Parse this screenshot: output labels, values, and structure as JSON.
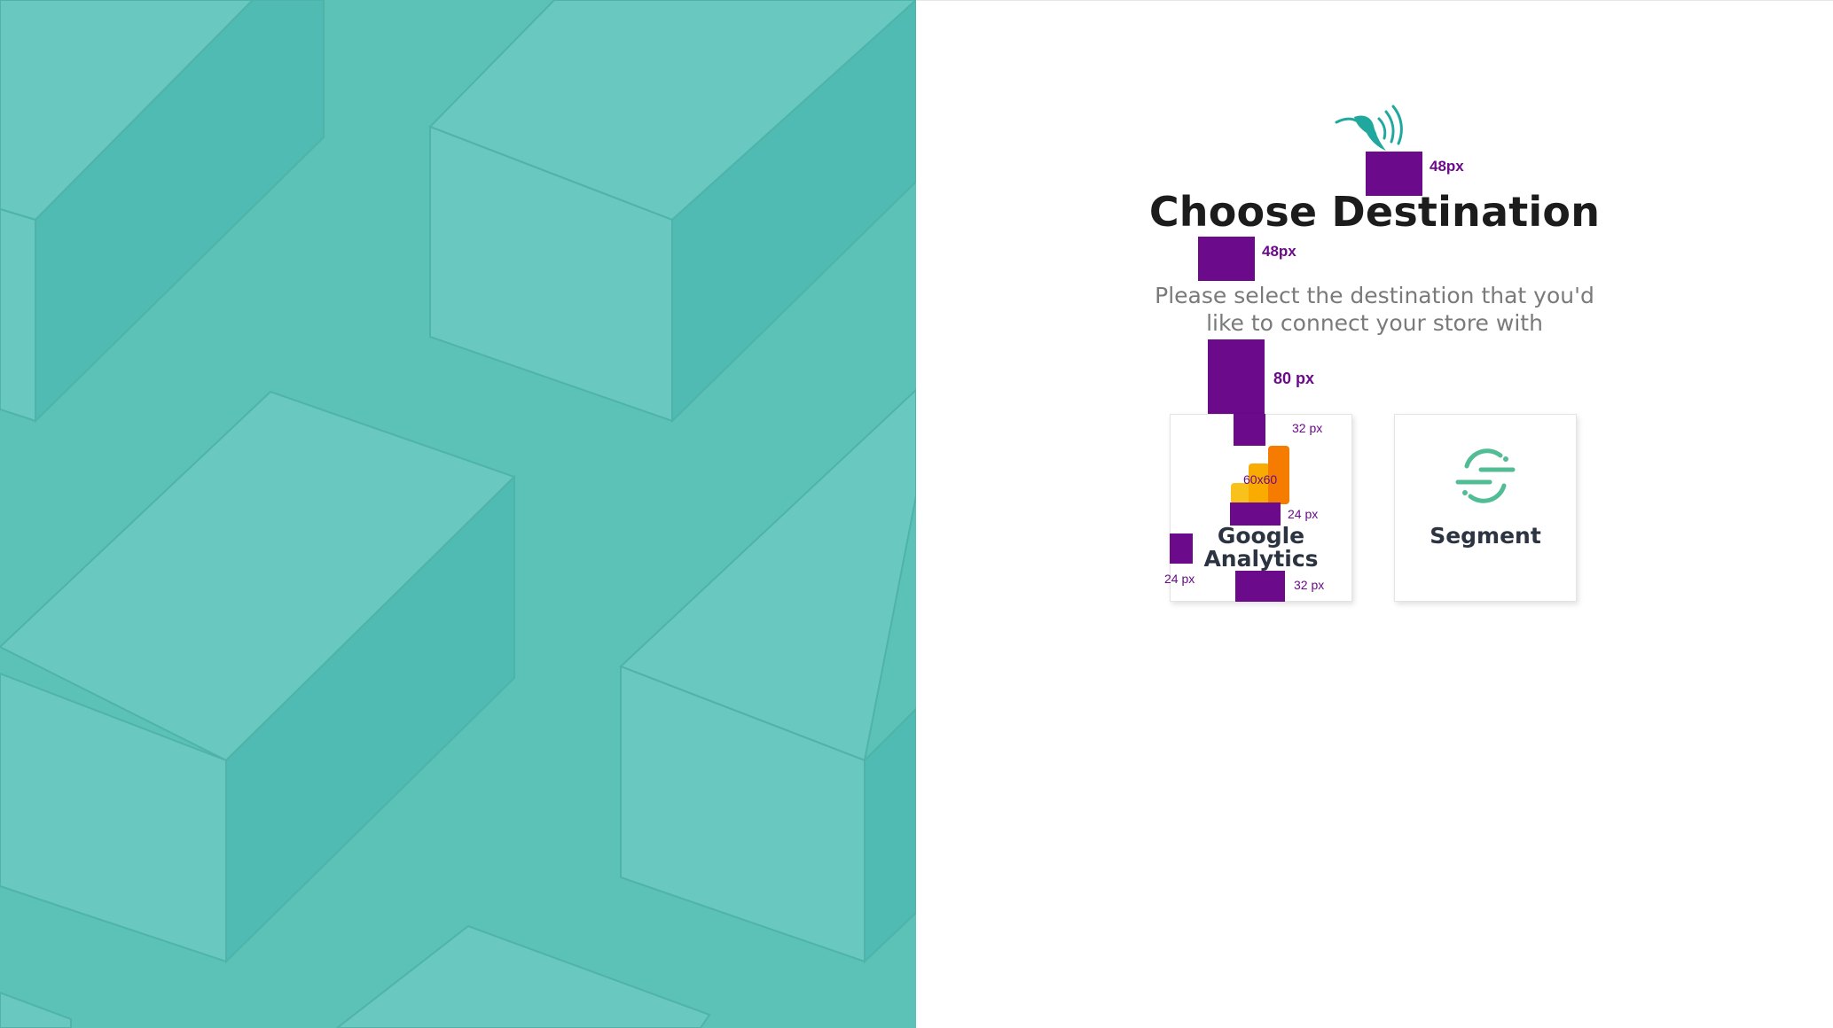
{
  "brand": {
    "logo_icon": "hummingbird-logo-icon",
    "accent_color": "#20a89e",
    "annotation_color": "#6b0a8a"
  },
  "heading": {
    "title": "Choose Destination",
    "subtitle": "Please select the destination that you'd like to connect your store with"
  },
  "annotations": {
    "logo_gap": "48px",
    "title_gap": "48px",
    "cards_gap": "80 px",
    "card_top_padding": "32 px",
    "icon_size": "60x60",
    "icon_label_gap": "24 px",
    "card_side_padding": "24 px",
    "card_bottom_padding": "32 px"
  },
  "destinations": [
    {
      "label": "Google Analytics",
      "icon": "google-analytics-icon"
    },
    {
      "label": "Segment",
      "icon": "segment-icon"
    }
  ]
}
